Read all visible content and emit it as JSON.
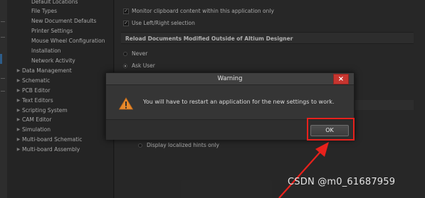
{
  "tree": {
    "sub_items": [
      "Default Locations",
      "File Types",
      "New Document Defaults",
      "Printer Settings",
      "Mouse Wheel Configuration",
      "Installation",
      "Network Activity"
    ],
    "top_items": [
      "Data Management",
      "Schematic",
      "PCB Editor",
      "Text Editors",
      "Scripting System",
      "CAM Editor",
      "Simulation",
      "Multi-board Schematic",
      "Multi-board Assembly"
    ]
  },
  "settings": {
    "clipboard_label": "Monitor clipboard content within this application only",
    "clipboard_checked": true,
    "leftright_label": "Use Left/Right selection",
    "leftright_checked": true,
    "reload_header": "Reload Documents Modified Outside of Altium Designer",
    "radio_never": "Never",
    "radio_ask_user": "Ask User",
    "selected_radio": "Ask User",
    "hints_label": "Display localized hints only",
    "hints_checked": false
  },
  "dialog": {
    "title": "Warning",
    "close_glyph": "×",
    "icon": "warning-triangle-icon",
    "message": "You will have to restart an application for the new settings to work.",
    "ok_label": "OK"
  },
  "annotation": {
    "highlight_color": "#e8211c"
  },
  "watermark": "CSDN @m0_61687959"
}
